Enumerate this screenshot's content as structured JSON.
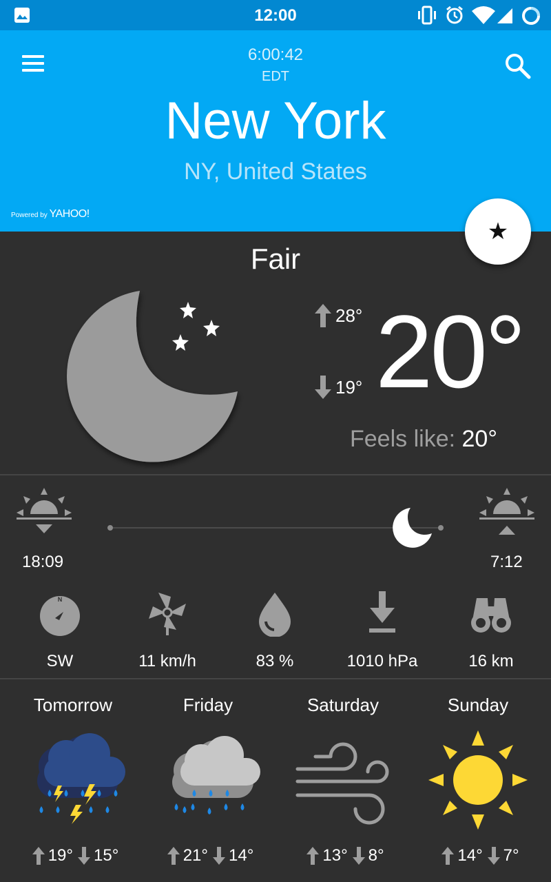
{
  "status_bar": {
    "time": "12:00",
    "icons": [
      "gallery-icon",
      "vibrate-icon",
      "alarm-icon",
      "wifi-icon",
      "signal-icon",
      "loading-icon"
    ]
  },
  "header": {
    "local_time": "6:00:42",
    "timezone": "EDT",
    "city": "New York",
    "region": "NY, United States",
    "powered_by": "Powered by",
    "provider": "YAHOO!",
    "background_color": "#03a9f4"
  },
  "favorite_button": {
    "icon": "star-icon",
    "glyph": "★"
  },
  "current": {
    "condition": "Fair",
    "icon": "moon-stars-icon",
    "high": "28°",
    "low": "19°",
    "temperature": "20°",
    "feels_like_label": "Feels like:",
    "feels_like_value": "20°"
  },
  "sun": {
    "sunset": "18:09",
    "sunrise": "7:12",
    "moon_progress_fraction": 0.92
  },
  "details": [
    {
      "name": "wind-direction",
      "icon": "compass-icon",
      "value": "SW"
    },
    {
      "name": "wind-speed",
      "icon": "pinwheel-icon",
      "value": "11 km/h"
    },
    {
      "name": "humidity",
      "icon": "drop-icon",
      "value": "83 %"
    },
    {
      "name": "pressure",
      "icon": "pressure-arrow-icon",
      "value": "1010 hPa"
    },
    {
      "name": "visibility",
      "icon": "binoculars-icon",
      "value": "16 km"
    }
  ],
  "forecast": [
    {
      "day": "Tomorrow",
      "icon": "thunderstorm-icon",
      "high": "19°",
      "low": "15°"
    },
    {
      "day": "Friday",
      "icon": "rain-cloud-icon",
      "high": "21°",
      "low": "14°"
    },
    {
      "day": "Saturday",
      "icon": "wind-icon",
      "high": "13°",
      "low": "8°"
    },
    {
      "day": "Sunday",
      "icon": "sun-icon",
      "high": "14°",
      "low": "7°"
    }
  ],
  "colors": {
    "accent": "#03a9f4",
    "statusbar": "#0288d1",
    "background": "#2f2f2f",
    "sun_yellow": "#fdd835",
    "rain_blue": "#1e88e5"
  }
}
